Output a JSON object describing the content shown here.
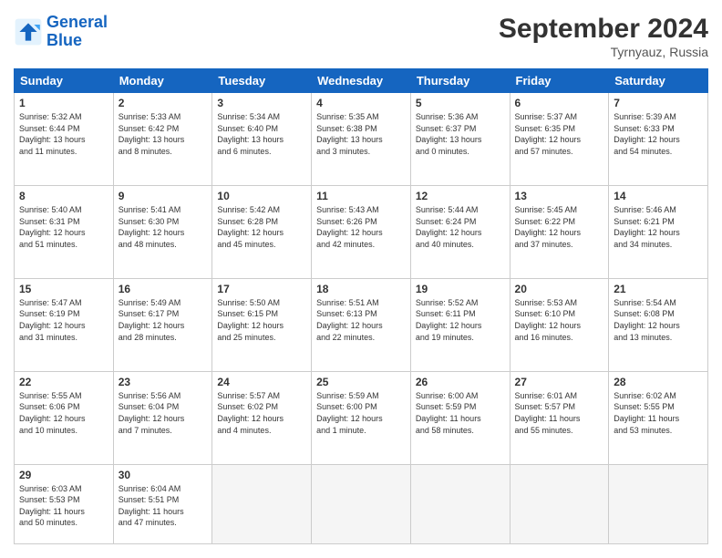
{
  "logo": {
    "line1": "General",
    "line2": "Blue"
  },
  "title": "September 2024",
  "subtitle": "Tyrnyauz, Russia",
  "headers": [
    "Sunday",
    "Monday",
    "Tuesday",
    "Wednesday",
    "Thursday",
    "Friday",
    "Saturday"
  ],
  "weeks": [
    [
      {
        "day": "1",
        "info": "Sunrise: 5:32 AM\nSunset: 6:44 PM\nDaylight: 13 hours\nand 11 minutes."
      },
      {
        "day": "2",
        "info": "Sunrise: 5:33 AM\nSunset: 6:42 PM\nDaylight: 13 hours\nand 8 minutes."
      },
      {
        "day": "3",
        "info": "Sunrise: 5:34 AM\nSunset: 6:40 PM\nDaylight: 13 hours\nand 6 minutes."
      },
      {
        "day": "4",
        "info": "Sunrise: 5:35 AM\nSunset: 6:38 PM\nDaylight: 13 hours\nand 3 minutes."
      },
      {
        "day": "5",
        "info": "Sunrise: 5:36 AM\nSunset: 6:37 PM\nDaylight: 13 hours\nand 0 minutes."
      },
      {
        "day": "6",
        "info": "Sunrise: 5:37 AM\nSunset: 6:35 PM\nDaylight: 12 hours\nand 57 minutes."
      },
      {
        "day": "7",
        "info": "Sunrise: 5:39 AM\nSunset: 6:33 PM\nDaylight: 12 hours\nand 54 minutes."
      }
    ],
    [
      {
        "day": "8",
        "info": "Sunrise: 5:40 AM\nSunset: 6:31 PM\nDaylight: 12 hours\nand 51 minutes."
      },
      {
        "day": "9",
        "info": "Sunrise: 5:41 AM\nSunset: 6:30 PM\nDaylight: 12 hours\nand 48 minutes."
      },
      {
        "day": "10",
        "info": "Sunrise: 5:42 AM\nSunset: 6:28 PM\nDaylight: 12 hours\nand 45 minutes."
      },
      {
        "day": "11",
        "info": "Sunrise: 5:43 AM\nSunset: 6:26 PM\nDaylight: 12 hours\nand 42 minutes."
      },
      {
        "day": "12",
        "info": "Sunrise: 5:44 AM\nSunset: 6:24 PM\nDaylight: 12 hours\nand 40 minutes."
      },
      {
        "day": "13",
        "info": "Sunrise: 5:45 AM\nSunset: 6:22 PM\nDaylight: 12 hours\nand 37 minutes."
      },
      {
        "day": "14",
        "info": "Sunrise: 5:46 AM\nSunset: 6:21 PM\nDaylight: 12 hours\nand 34 minutes."
      }
    ],
    [
      {
        "day": "15",
        "info": "Sunrise: 5:47 AM\nSunset: 6:19 PM\nDaylight: 12 hours\nand 31 minutes."
      },
      {
        "day": "16",
        "info": "Sunrise: 5:49 AM\nSunset: 6:17 PM\nDaylight: 12 hours\nand 28 minutes."
      },
      {
        "day": "17",
        "info": "Sunrise: 5:50 AM\nSunset: 6:15 PM\nDaylight: 12 hours\nand 25 minutes."
      },
      {
        "day": "18",
        "info": "Sunrise: 5:51 AM\nSunset: 6:13 PM\nDaylight: 12 hours\nand 22 minutes."
      },
      {
        "day": "19",
        "info": "Sunrise: 5:52 AM\nSunset: 6:11 PM\nDaylight: 12 hours\nand 19 minutes."
      },
      {
        "day": "20",
        "info": "Sunrise: 5:53 AM\nSunset: 6:10 PM\nDaylight: 12 hours\nand 16 minutes."
      },
      {
        "day": "21",
        "info": "Sunrise: 5:54 AM\nSunset: 6:08 PM\nDaylight: 12 hours\nand 13 minutes."
      }
    ],
    [
      {
        "day": "22",
        "info": "Sunrise: 5:55 AM\nSunset: 6:06 PM\nDaylight: 12 hours\nand 10 minutes."
      },
      {
        "day": "23",
        "info": "Sunrise: 5:56 AM\nSunset: 6:04 PM\nDaylight: 12 hours\nand 7 minutes."
      },
      {
        "day": "24",
        "info": "Sunrise: 5:57 AM\nSunset: 6:02 PM\nDaylight: 12 hours\nand 4 minutes."
      },
      {
        "day": "25",
        "info": "Sunrise: 5:59 AM\nSunset: 6:00 PM\nDaylight: 12 hours\nand 1 minute."
      },
      {
        "day": "26",
        "info": "Sunrise: 6:00 AM\nSunset: 5:59 PM\nDaylight: 11 hours\nand 58 minutes."
      },
      {
        "day": "27",
        "info": "Sunrise: 6:01 AM\nSunset: 5:57 PM\nDaylight: 11 hours\nand 55 minutes."
      },
      {
        "day": "28",
        "info": "Sunrise: 6:02 AM\nSunset: 5:55 PM\nDaylight: 11 hours\nand 53 minutes."
      }
    ],
    [
      {
        "day": "29",
        "info": "Sunrise: 6:03 AM\nSunset: 5:53 PM\nDaylight: 11 hours\nand 50 minutes."
      },
      {
        "day": "30",
        "info": "Sunrise: 6:04 AM\nSunset: 5:51 PM\nDaylight: 11 hours\nand 47 minutes."
      },
      {
        "day": "",
        "info": ""
      },
      {
        "day": "",
        "info": ""
      },
      {
        "day": "",
        "info": ""
      },
      {
        "day": "",
        "info": ""
      },
      {
        "day": "",
        "info": ""
      }
    ]
  ]
}
